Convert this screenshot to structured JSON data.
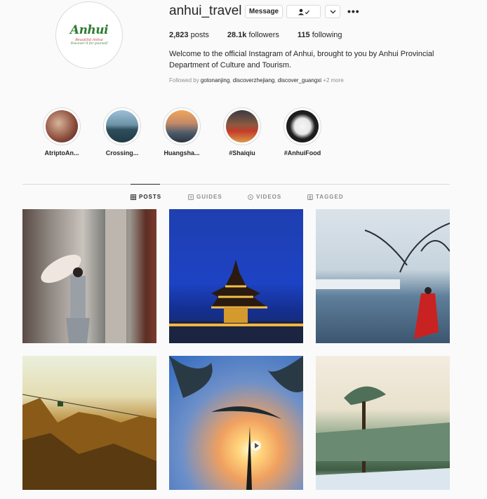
{
  "profile": {
    "username": "anhui_travel",
    "logo_word": "Anhui",
    "logo_tag1": "Beautiful Anhui",
    "logo_tag2": "Discover it for yourself",
    "message_label": "Message",
    "follow_icon": "person-check-icon",
    "chevron_icon": "chevron-down-icon",
    "more_icon": "ellipsis-icon",
    "more_glyph": "•••",
    "stats": {
      "posts_count": "2,823",
      "posts_label": "posts",
      "followers_count": "28.1k",
      "followers_label": "followers",
      "following_count": "115",
      "following_label": "following"
    },
    "bio": "Welcome to the official Instagram of Anhui, brought to you by Anhui Provincial Department of Culture and Tourism.",
    "followed_by": {
      "prefix": "Followed by",
      "accounts": [
        "gotonanjing",
        "discoverzhejiang",
        "discover_guangxi"
      ],
      "more": "+2 more"
    }
  },
  "highlights": [
    {
      "label": "AtriptoAn..."
    },
    {
      "label": "Crossing..."
    },
    {
      "label": "Huangsha..."
    },
    {
      "label": "#Shaiqiu"
    },
    {
      "label": "#AnhuiFood"
    }
  ],
  "tabs": [
    {
      "label": "POSTS",
      "icon": "grid-icon",
      "active": true
    },
    {
      "label": "GUIDES",
      "icon": "guide-icon",
      "active": false
    },
    {
      "label": "VIDEOS",
      "icon": "video-icon",
      "active": false
    },
    {
      "label": "TAGGED",
      "icon": "tag-icon",
      "active": false
    }
  ],
  "posts": [
    {
      "subject": "woman-with-parasol"
    },
    {
      "subject": "lit-pavilion-night"
    },
    {
      "subject": "lake-village-red-cloak"
    },
    {
      "subject": "huangshan-cable-car"
    },
    {
      "subject": "pine-sunset"
    },
    {
      "subject": "snowy-pine-forest"
    }
  ]
}
